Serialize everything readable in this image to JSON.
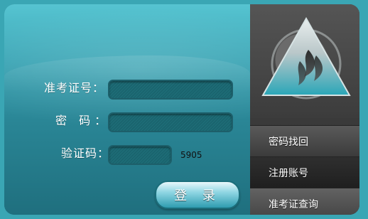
{
  "form": {
    "ticket_label": "准考证号：",
    "password_label": "密  码：",
    "captcha_label": "验证码：",
    "captcha_code": "5905",
    "login_button": "登 录"
  },
  "side_menu": {
    "items": [
      {
        "label": "密码找回"
      },
      {
        "label": "注册账号"
      },
      {
        "label": "准考证查询"
      }
    ]
  },
  "colors": {
    "teal": "#3aa6b4",
    "dark_teal": "#1f6f7e",
    "menu_dark": "#2c2c2c"
  },
  "icons": {
    "logo": "triangle-flame-logo-icon"
  }
}
